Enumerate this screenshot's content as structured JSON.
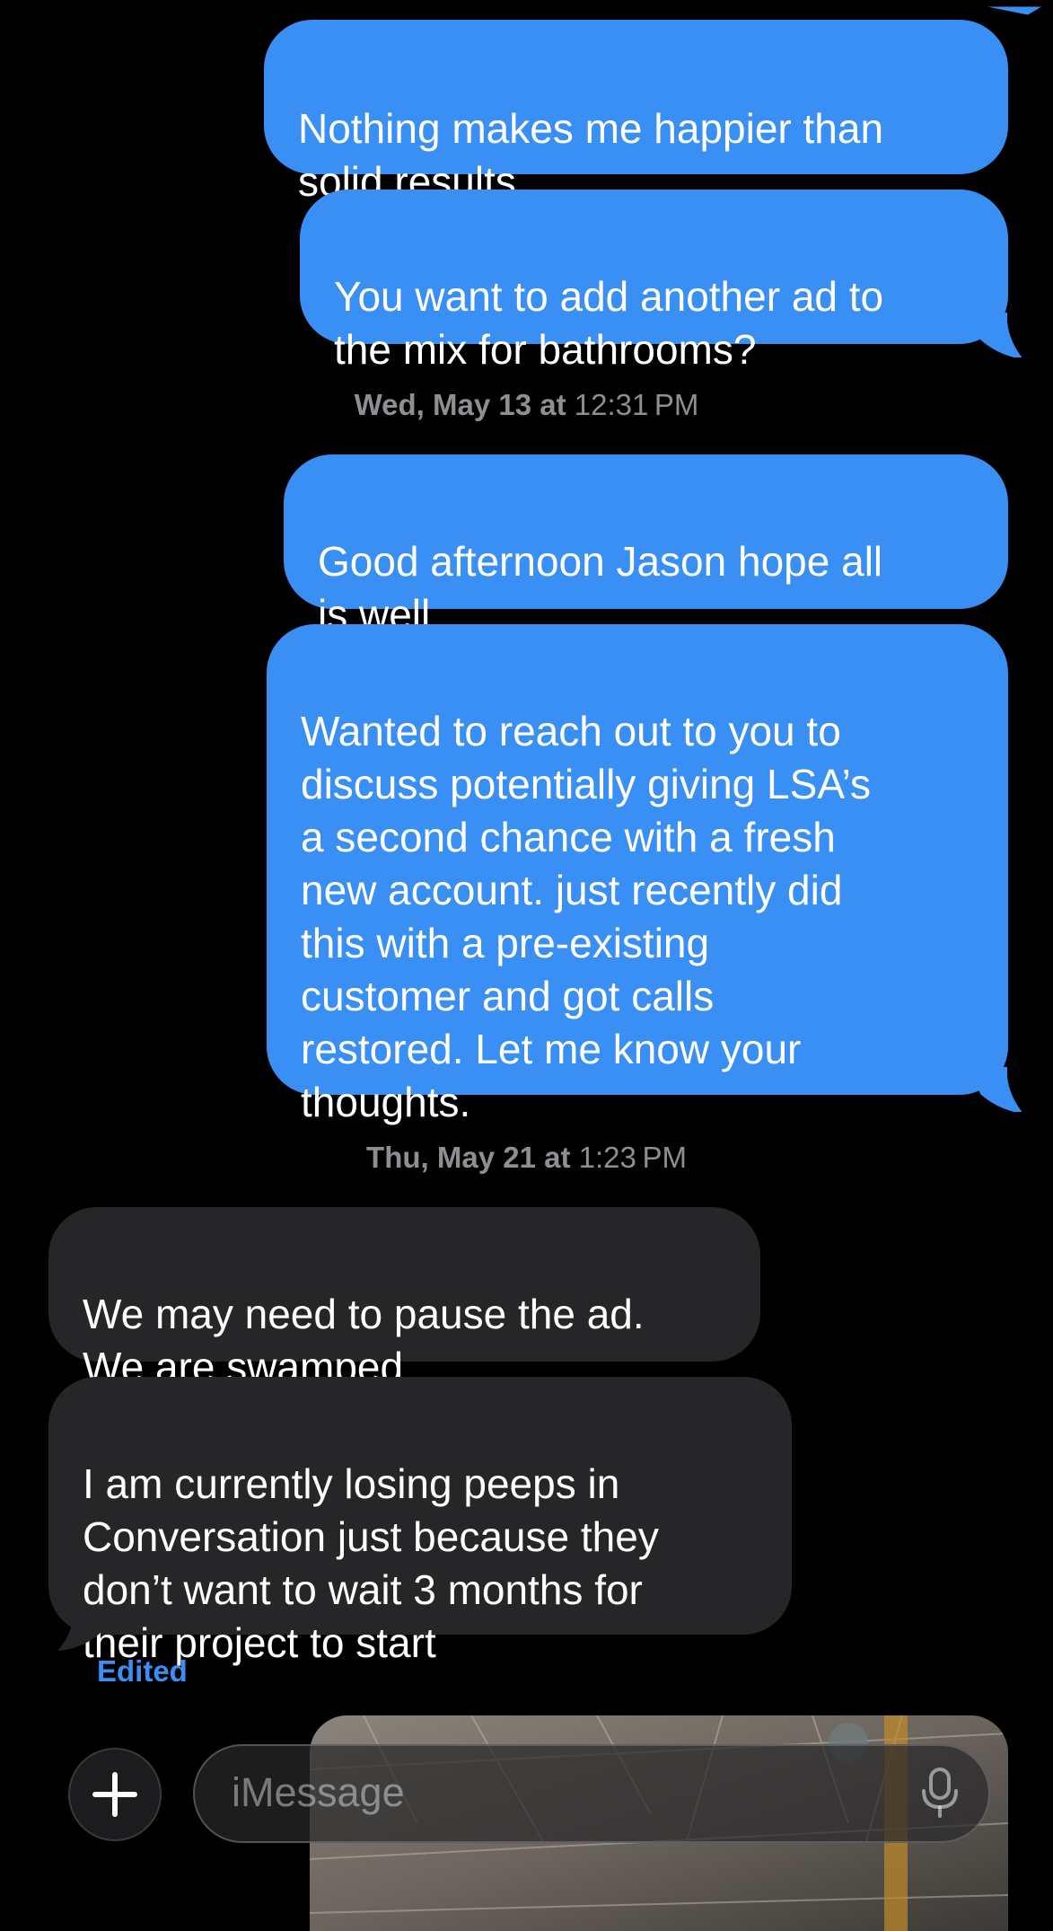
{
  "messages": [
    {
      "direction": "outgoing",
      "text": "Nothing makes me happier than\nsolid results"
    },
    {
      "direction": "outgoing",
      "text": "You want to add another ad to\nthe mix for bathrooms?"
    },
    {
      "direction": "outgoing",
      "text": "Good afternoon Jason hope all\nis well"
    },
    {
      "direction": "outgoing",
      "text": "Wanted to reach out to you to\ndiscuss potentially giving LSA’s\na second chance with a fresh\nnew account. just recently did\nthis with a pre-existing\ncustomer and got calls\nrestored. Let me know your\nthoughts."
    },
    {
      "direction": "incoming",
      "text": "We may need to pause the ad.\nWe are swamped"
    },
    {
      "direction": "incoming",
      "text": "I am currently losing peeps in\nConversation just because they\ndon’t want to wait 3 months for\ntheir project to start"
    }
  ],
  "timestamps": [
    {
      "day": "Wed, May 13 at",
      "time": "12:31 PM"
    },
    {
      "day": "Thu, May 21 at",
      "time": "1:23 PM"
    }
  ],
  "edited_label": "Edited",
  "composer": {
    "placeholder": "iMessage",
    "plus_icon": "plus-icon",
    "mic_icon": "microphone-icon"
  },
  "colors": {
    "outgoing_bubble": "#3a8ff5",
    "incoming_bubble": "#262628",
    "background": "#000000",
    "timestamp_text": "#8e8e93",
    "edited_text": "#3a8ff5"
  }
}
